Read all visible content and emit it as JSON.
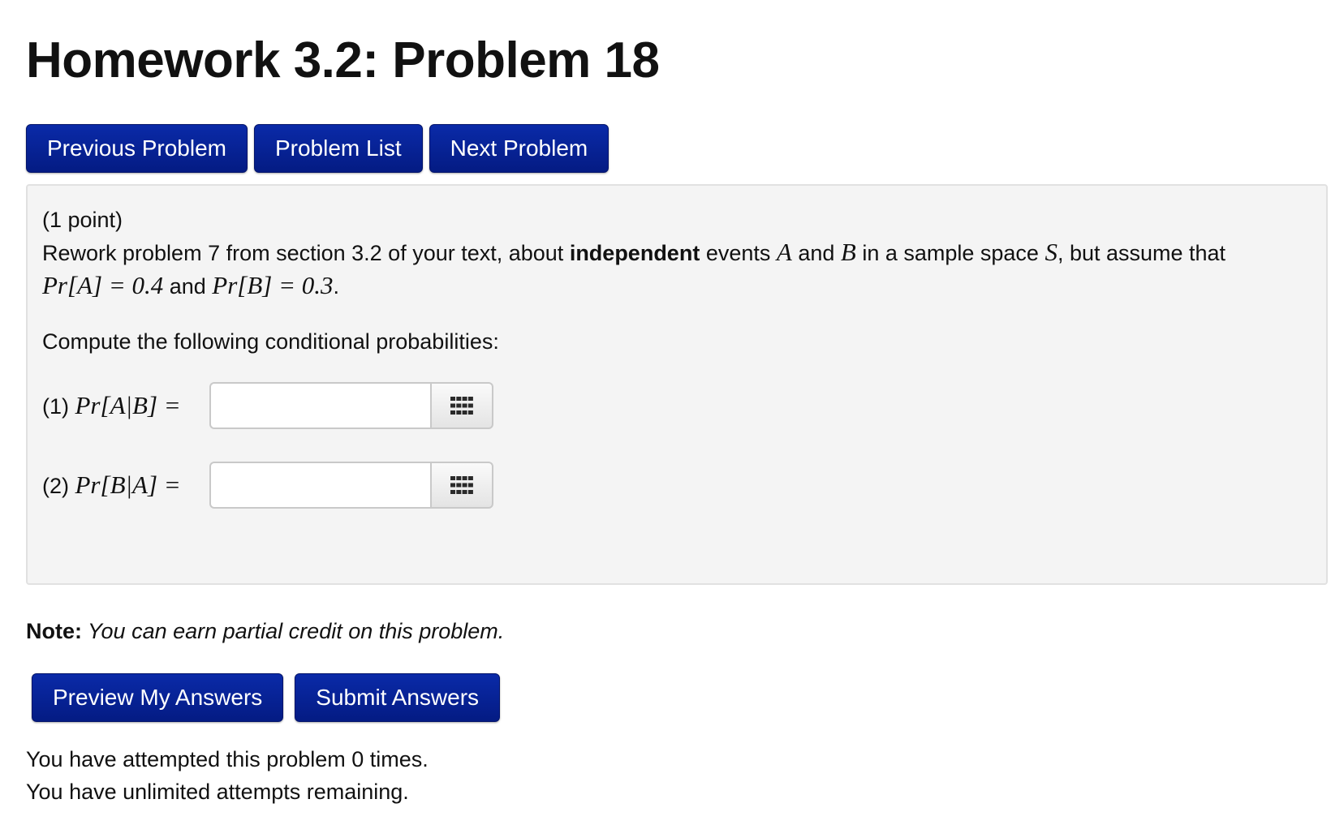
{
  "page": {
    "title": "Homework 3.2: Problem 18"
  },
  "nav": {
    "previous_label": "Previous Problem",
    "list_label": "Problem List",
    "next_label": "Next Problem"
  },
  "problem": {
    "points": "(1 point)",
    "intro_1": "Rework problem 7 from section 3.2 of your text, about ",
    "intro_bold": "independent",
    "intro_2": " events ",
    "event_a": "A",
    "and_1": " and ",
    "event_b": "B",
    "intro_3": " in a sample space ",
    "space": "S",
    "intro_4": ", but assume that",
    "given_a": "Pr[A] = 0.4",
    "and_2": " and ",
    "given_b": "Pr[B] = 0.3",
    "period": ".",
    "instruction": "Compute the following conditional probabilities:",
    "answers": [
      {
        "prefix": "(1) ",
        "expression": "Pr[A|B] =",
        "value": "",
        "palette_icon": "grid-icon"
      },
      {
        "prefix": "(2) ",
        "expression": "Pr[B|A] =",
        "value": "",
        "palette_icon": "grid-icon"
      }
    ]
  },
  "note": {
    "label": "Note:",
    "text": " You can earn partial credit on this problem."
  },
  "actions": {
    "preview_label": "Preview My Answers",
    "submit_label": "Submit Answers"
  },
  "status": {
    "attempts": "You have attempted this problem 0 times.",
    "remaining": "You have unlimited attempts remaining."
  },
  "colors": {
    "button": "#041b83",
    "panel": "#f4f4f4"
  }
}
